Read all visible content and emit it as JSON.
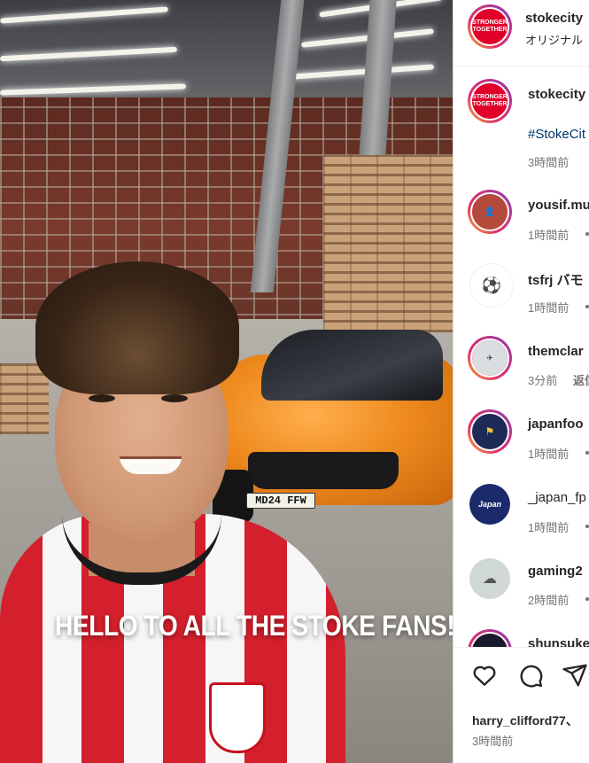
{
  "video": {
    "caption": "HELLO TO ALL THE STOKE FANS!",
    "plate": "MD24 FFW"
  },
  "header": {
    "username": "stokecity",
    "subtitle": "オリジナル",
    "avatar_text": "STRONGER TOGETHER"
  },
  "post": {
    "username": "stokecity",
    "hashtag": "#StokeCit",
    "time": "3時間前"
  },
  "comments": [
    {
      "username": "yousif.mu",
      "time": "1時間前"
    },
    {
      "username": "tsfrj バモ",
      "time": "1時間前"
    },
    {
      "username": "themclar",
      "time": "3分前",
      "reply": "返信"
    },
    {
      "username": "japanfoo",
      "time": "1時間前"
    },
    {
      "username": "_japan_fp",
      "time": "1時間前"
    },
    {
      "username": "gaming2",
      "time": "2時間前"
    },
    {
      "username": "shunsuke",
      "time": ""
    }
  ],
  "actions": {
    "liked_by": "harry_clifford77、",
    "post_time": "3時間前",
    "like_icon": "heart-icon",
    "comment_icon": "comment-icon",
    "share_icon": "share-icon"
  },
  "colors": {
    "accent": "#e0002a",
    "link": "#00376b",
    "muted": "#737373"
  }
}
